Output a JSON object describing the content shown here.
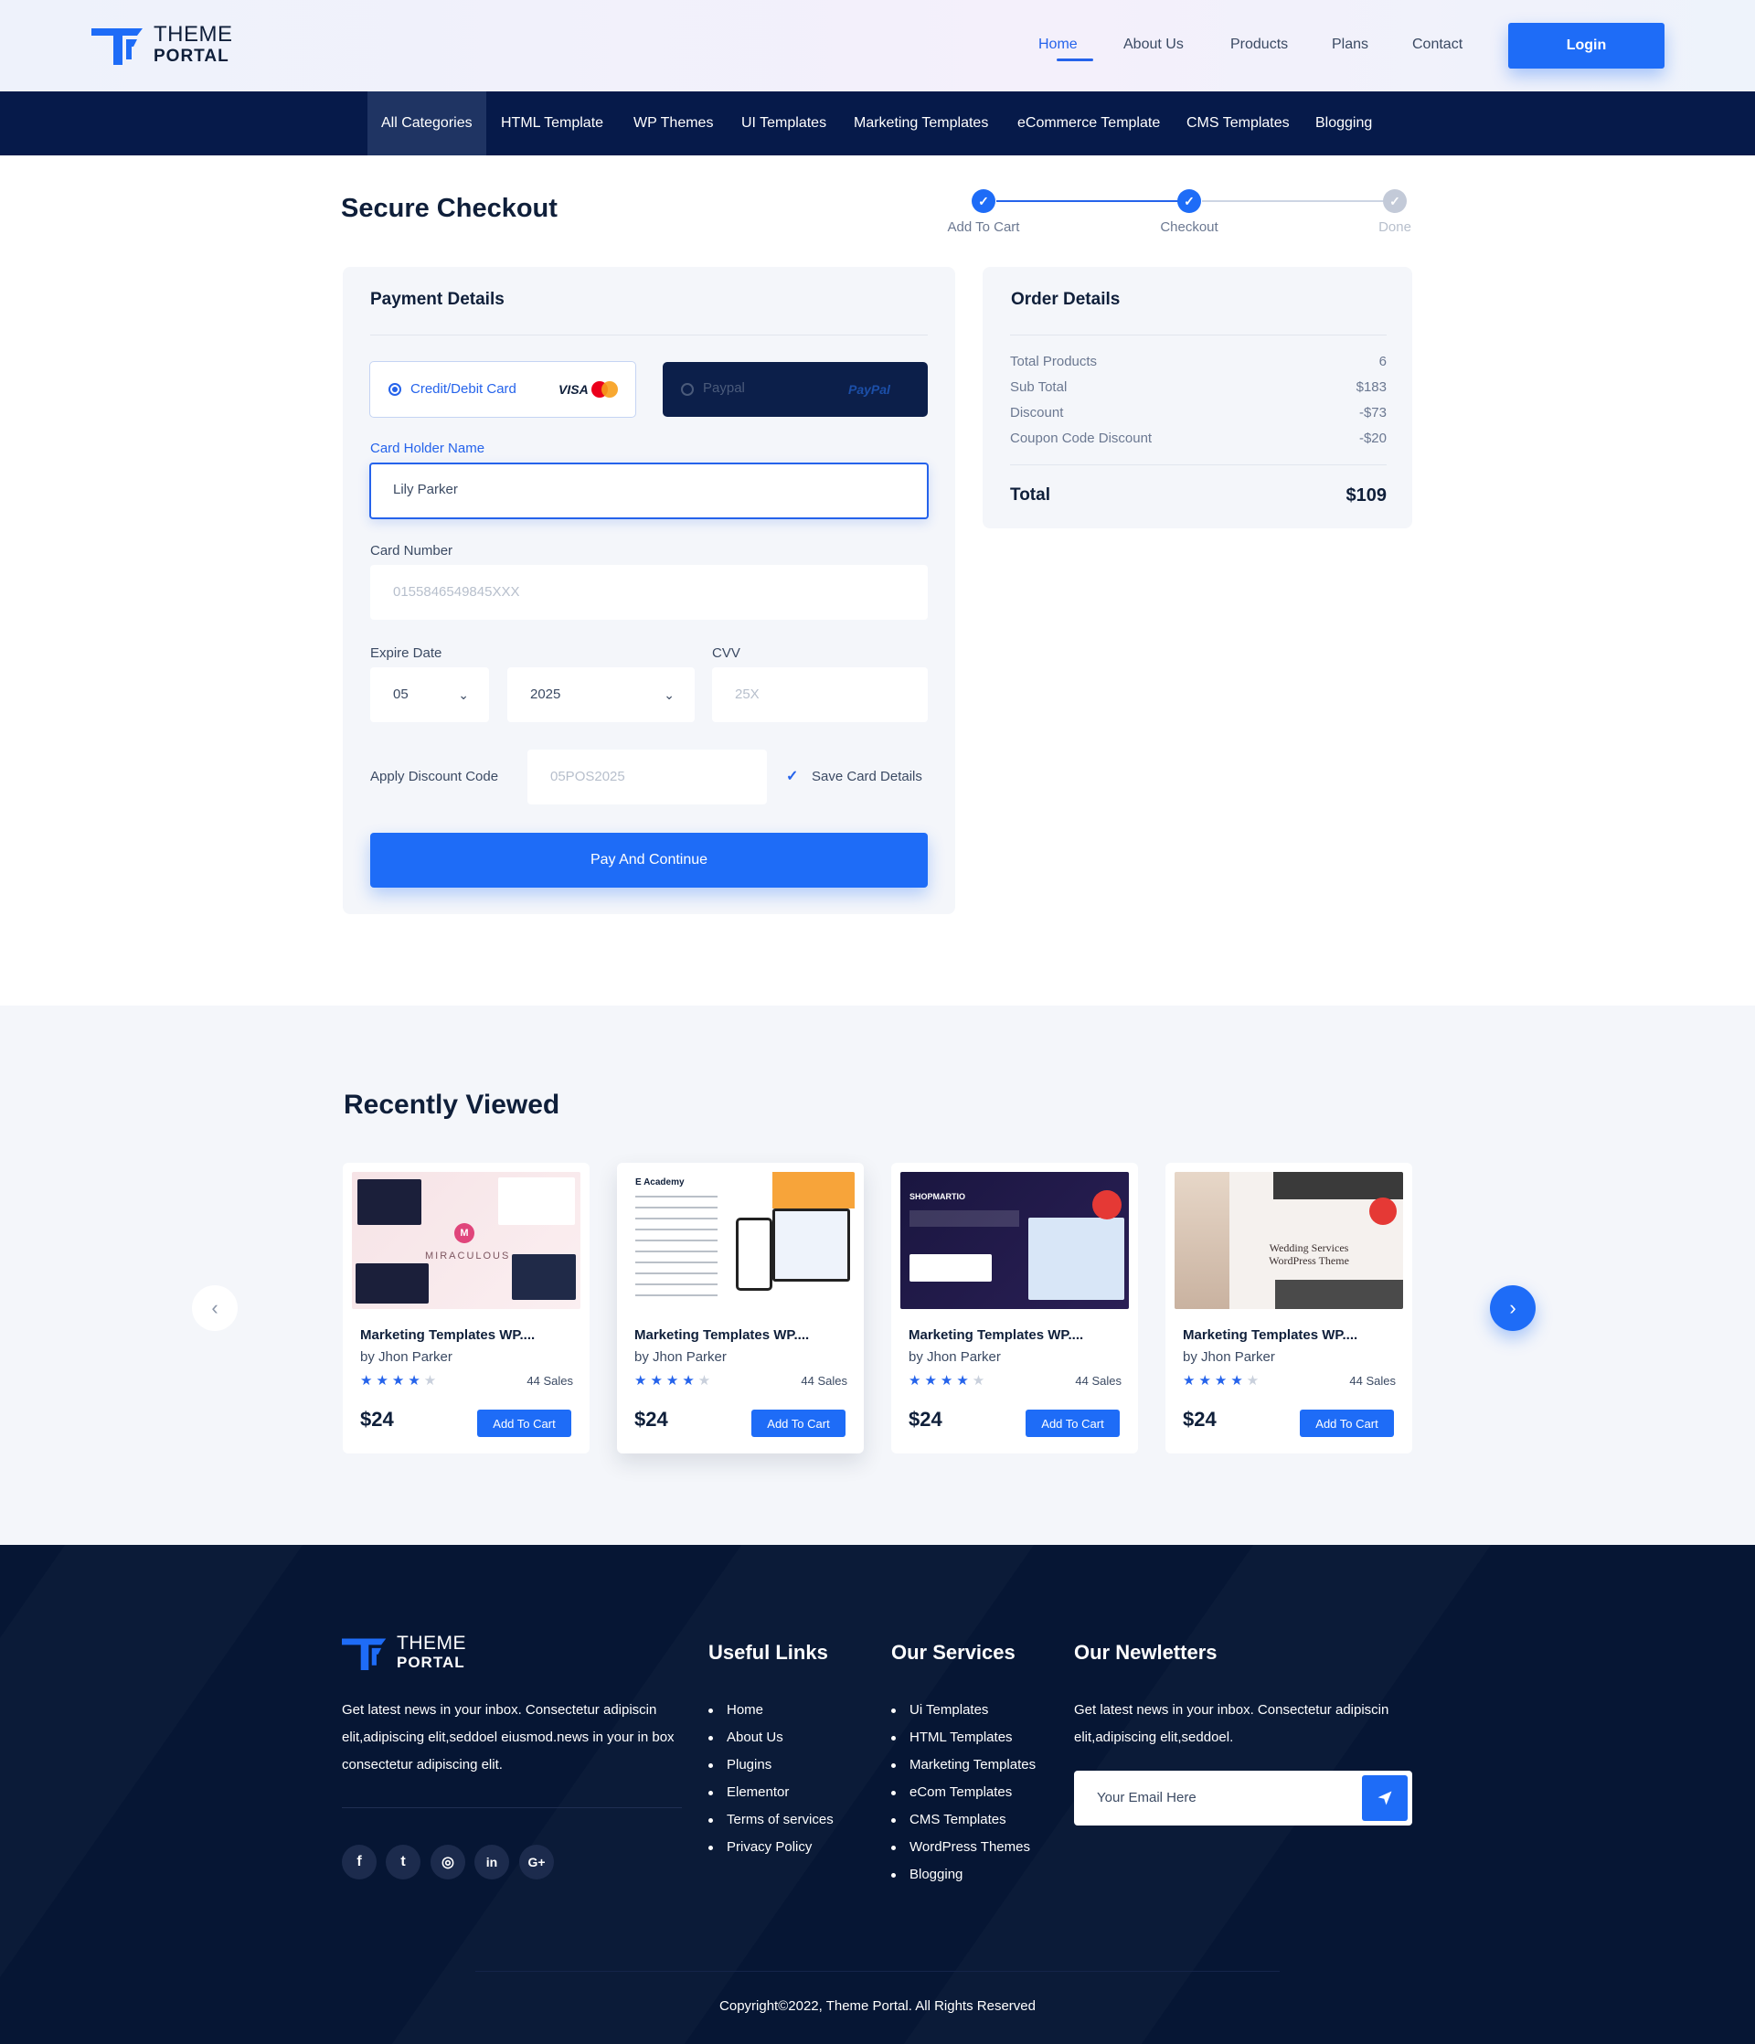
{
  "header": {
    "logo_line1": "THEME",
    "logo_line2": "PORTAL",
    "nav": [
      "Home",
      "About Us",
      "Products",
      "Plans",
      "Contact"
    ],
    "login_label": "Login"
  },
  "categories": [
    "All Categories",
    "HTML Template",
    "WP Themes",
    "UI Templates",
    "Marketing Templates",
    "eCommerce Template",
    "CMS Templates",
    "Blogging"
  ],
  "checkout": {
    "title": "Secure Checkout",
    "steps": [
      {
        "label": "Add To Cart",
        "status": "done"
      },
      {
        "label": "Checkout",
        "status": "done"
      },
      {
        "label": "Done",
        "status": "pending"
      }
    ]
  },
  "payment": {
    "title": "Payment Details",
    "option_card": "Credit/Debit Card",
    "option_card_brand": "VISA",
    "option_paypal": "Paypal",
    "paypal_brand": "PayPal",
    "holder_label": "Card Holder Name",
    "holder_value": "Lily Parker",
    "number_label": "Card Number",
    "number_placeholder": "0155846549845XXX",
    "expire_label": "Expire Date",
    "expire_month": "05",
    "expire_year": "2025",
    "cvv_label": "CVV",
    "cvv_placeholder": "25X",
    "discount_label": "Apply Discount Code",
    "discount_placeholder": "05POS2025",
    "save_label": "Save Card Details",
    "pay_label": "Pay And Continue"
  },
  "order": {
    "title": "Order Details",
    "rows": [
      {
        "label": "Total Products",
        "value": "6"
      },
      {
        "label": "Sub Total",
        "value": "$183"
      },
      {
        "label": "Discount",
        "value": "-$73"
      },
      {
        "label": "Coupon Code Discount",
        "value": "-$20"
      }
    ],
    "total_label": "Total",
    "total_value": "$109"
  },
  "recent": {
    "title": "Recently Viewed",
    "products": [
      {
        "name": "Marketing Templates WP....",
        "by": "by Jhon Parker",
        "rating": 4,
        "sales": "44 Sales",
        "price": "$24",
        "cart_label": "Add To Cart",
        "thumb_text": "MIRACULOUS"
      },
      {
        "name": "Marketing Templates WP....",
        "by": "by Jhon Parker",
        "rating": 4,
        "sales": "44 Sales",
        "price": "$24",
        "cart_label": "Add To Cart",
        "thumb_text": "E Academy"
      },
      {
        "name": "Marketing Templates WP....",
        "by": "by Jhon Parker",
        "rating": 4,
        "sales": "44 Sales",
        "price": "$24",
        "cart_label": "Add To Cart",
        "thumb_text": "SHOPMARTIO"
      },
      {
        "name": "Marketing Templates WP....",
        "by": "by Jhon Parker",
        "rating": 4,
        "sales": "44 Sales",
        "price": "$24",
        "cart_label": "Add To Cart",
        "thumb_text": "Wedding Services WordPress Theme"
      }
    ]
  },
  "footer": {
    "about": "Get latest news in your inbox. Consectetur adipiscin elit,adipiscing elit,seddoel eiusmod.news in your in box consectetur adipiscing elit.",
    "useful_title": "Useful Links",
    "useful_links": [
      "Home",
      "About Us",
      "Plugins",
      "Elementor",
      "Terms of services",
      "Privacy Policy"
    ],
    "services_title": "Our Services",
    "services": [
      "Ui Templates",
      "HTML Templates",
      "Marketing Templates",
      "eCom Templates",
      "CMS Templates",
      "WordPress Themes",
      "Blogging"
    ],
    "news_title": "Our Newletters",
    "news_text": "Get latest news in your inbox. Consectetur adipiscin elit,adipiscing elit,seddoel.",
    "email_placeholder": "Your Email Here",
    "social": [
      "f",
      "t",
      "◎",
      "in",
      "G+"
    ],
    "copyright": "Copyright©2022, Theme Portal. All Rights Reserved"
  },
  "colors": {
    "accent": "#1e6cf7",
    "navy": "#061a4a",
    "footer": "#061634",
    "star": "#2563eb"
  }
}
